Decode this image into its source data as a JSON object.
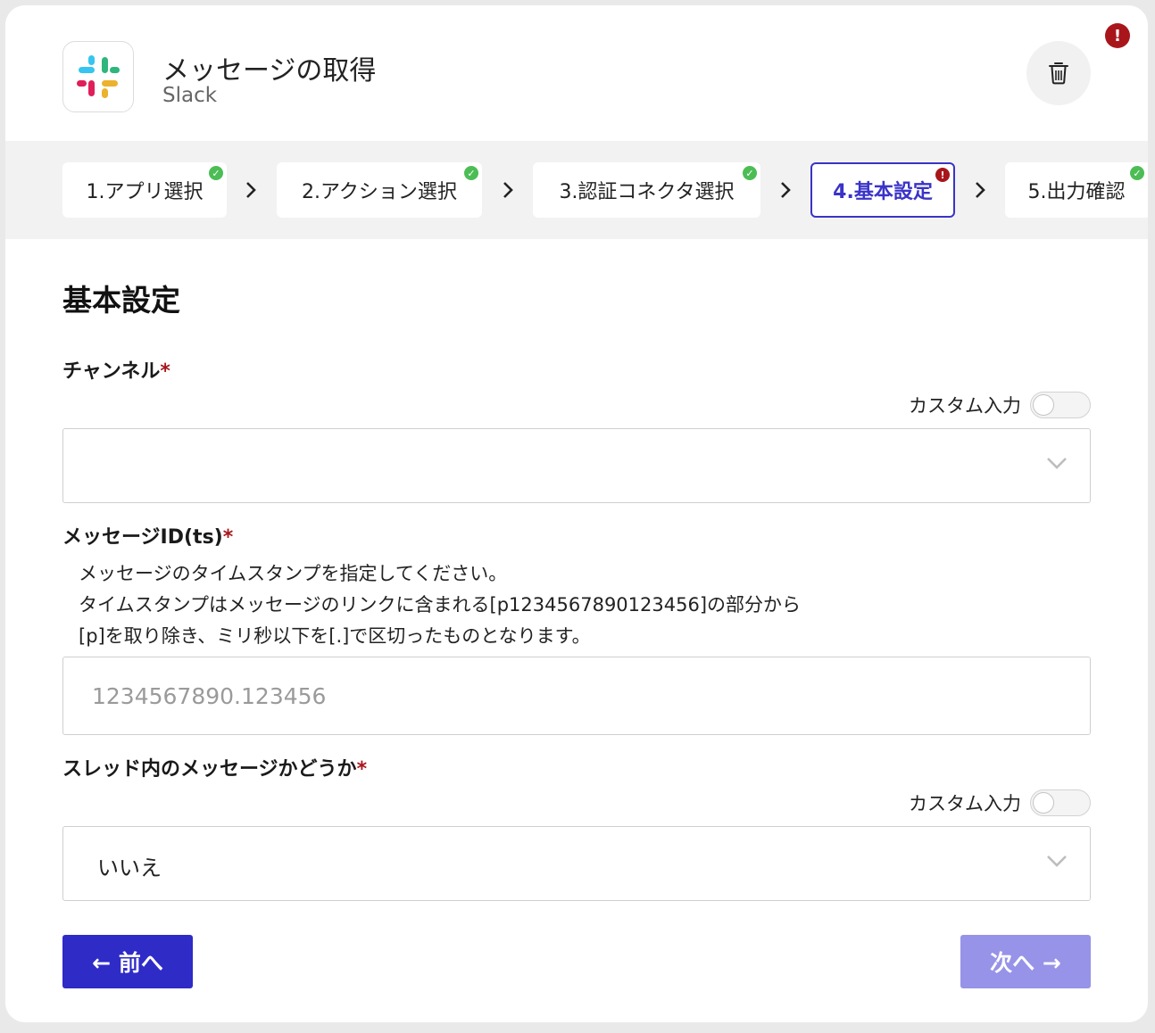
{
  "header": {
    "title": "メッセージの取得",
    "app_name": "Slack",
    "delete_icon": "trash-icon",
    "error_badge": "!"
  },
  "steps": [
    {
      "label": "1.アプリ選択",
      "status": "complete"
    },
    {
      "label": "2.アクション選択",
      "status": "complete"
    },
    {
      "label": "3.認証コネクタ選択",
      "status": "complete"
    },
    {
      "label": "4.基本設定",
      "status": "error",
      "active": true
    },
    {
      "label": "5.出力確認",
      "status": "complete"
    }
  ],
  "form": {
    "section_title": "基本設定",
    "channel": {
      "label": "チャンネル",
      "required_mark": "*",
      "custom_input_label": "カスタム入力",
      "custom_input_on": false,
      "selected_value": ""
    },
    "message_id": {
      "label": "メッセージID(ts)",
      "required_mark": "*",
      "help_lines": [
        "メッセージのタイムスタンプを指定してください。",
        "タイムスタンプはメッセージのリンクに含まれる[p1234567890123456]の部分から",
        "[p]を取り除き、ミリ秒以下を[.]で区切ったものとなります。"
      ],
      "placeholder": "1234567890.123456",
      "value": ""
    },
    "in_thread": {
      "label": "スレッド内のメッセージかどうか",
      "required_mark": "*",
      "custom_input_label": "カスタム入力",
      "custom_input_on": false,
      "selected_value": "いいえ"
    }
  },
  "buttons": {
    "prev_label": "← 前へ",
    "next_label": "次へ →",
    "next_disabled": true
  },
  "colors": {
    "primary": "#2f2bc7",
    "primary_disabled": "#9793e8",
    "success": "#4cbd55",
    "error": "#a8161b"
  }
}
